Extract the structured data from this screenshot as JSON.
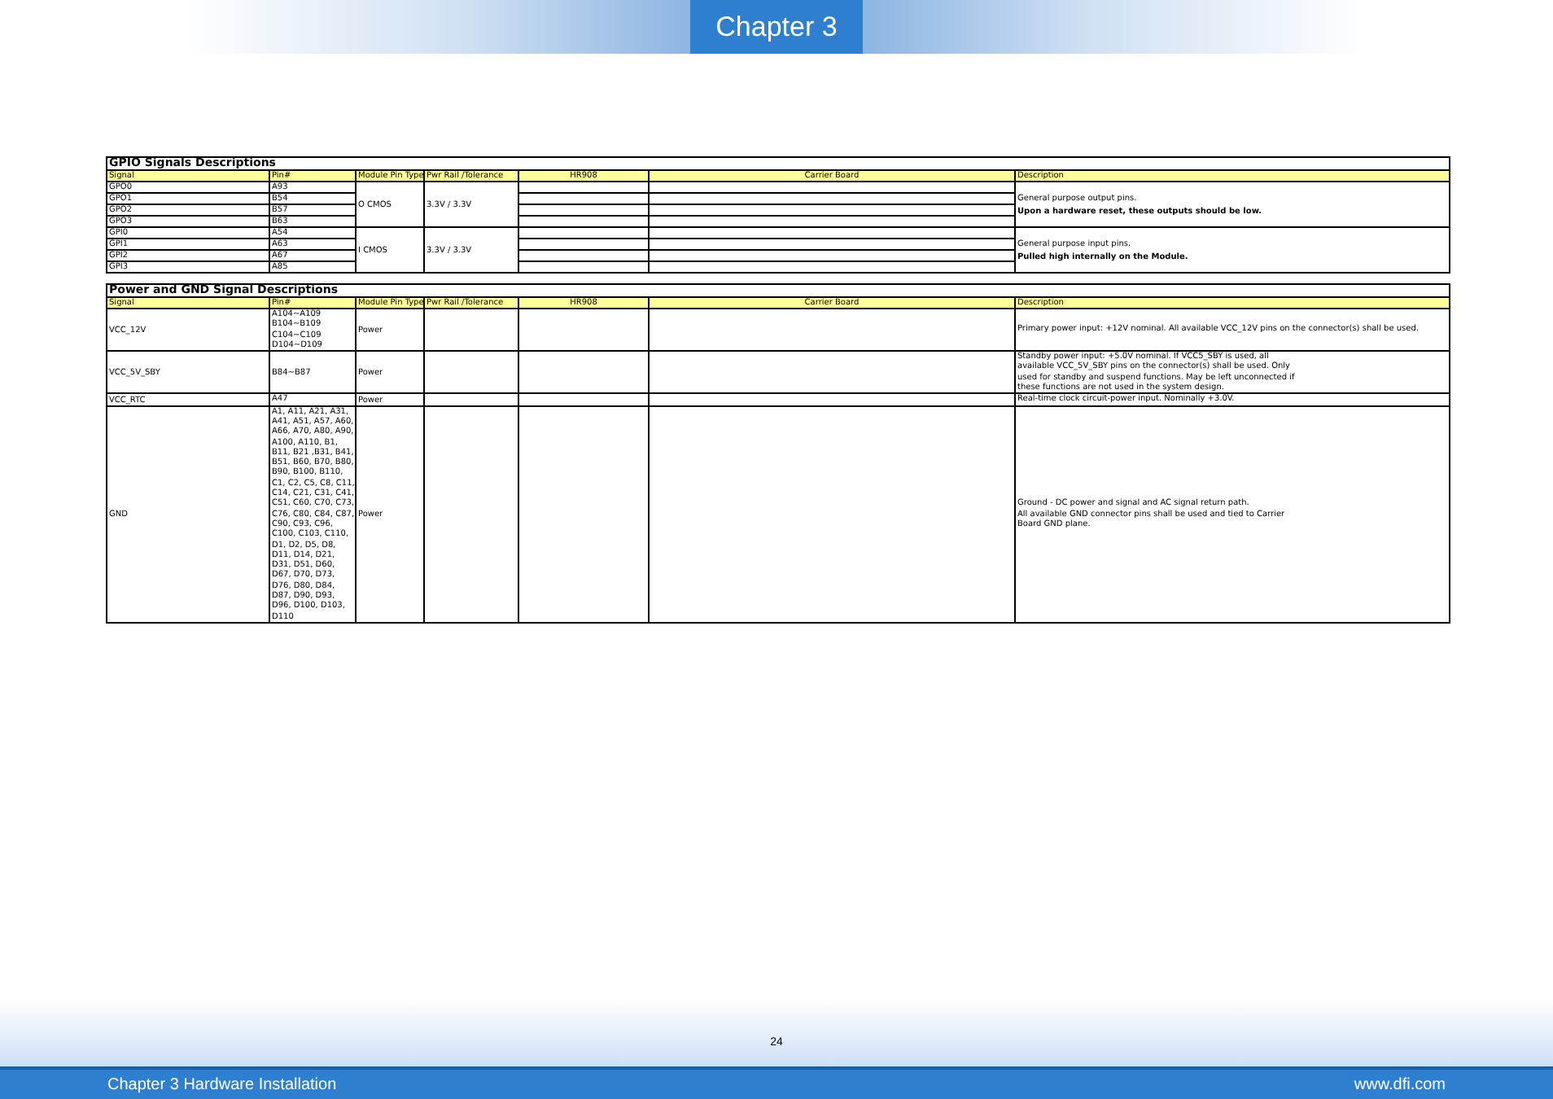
{
  "header": {
    "chapter_tab": "Chapter 3"
  },
  "gpio_table": {
    "title": "GPIO Signals Descriptions",
    "columns": [
      "Signal",
      "Pin#",
      "Module Pin Type",
      "Pwr Rail /Tolerance",
      "HR908",
      "Carrier Board",
      "Description"
    ],
    "groups": [
      {
        "type": "O CMOS",
        "rail": "3.3V / 3.3V",
        "description": [
          {
            "text": "General purpose output pins.",
            "bold": false
          },
          {
            "text": "Upon a hardware reset, these outputs should be low.",
            "bold": true
          }
        ],
        "signals": [
          {
            "signal": "GPO0",
            "pin": "A93"
          },
          {
            "signal": "GPO1",
            "pin": "B54"
          },
          {
            "signal": "GPO2",
            "pin": "B57"
          },
          {
            "signal": "GPO3",
            "pin": "B63"
          }
        ]
      },
      {
        "type": "I CMOS",
        "rail": "3.3V / 3.3V",
        "description": [
          {
            "text": "General purpose input pins.",
            "bold": false
          },
          {
            "text": "Pulled high internally on the Module.",
            "bold": true
          }
        ],
        "signals": [
          {
            "signal": "GPI0",
            "pin": "A54"
          },
          {
            "signal": "GPI1",
            "pin": "A63"
          },
          {
            "signal": "GPI2",
            "pin": "A67"
          },
          {
            "signal": "GPI3",
            "pin": "A85"
          }
        ]
      }
    ]
  },
  "power_table": {
    "title": "Power and GND Signal Descriptions",
    "columns": [
      "Signal",
      "Pin#",
      "Module Pin Type",
      "Pwr Rail /Tolerance",
      "HR908",
      "Carrier Board",
      "Description"
    ],
    "rows": [
      {
        "signal": "VCC_12V",
        "pins": [
          "A104~A109",
          "B104~B109",
          "C104~C109",
          "D104~D109"
        ],
        "type": "Power",
        "description": [
          "Primary power input: +12V nominal. All available VCC_12V pins on the connector(s) shall be used."
        ]
      },
      {
        "signal": "VCC_5V_SBY",
        "pins": [
          "B84~B87"
        ],
        "type": "Power",
        "description": [
          "Standby power input: +5.0V nominal. If VCC5_SBY is used, all",
          "available VCC_5V_SBY pins on the connector(s) shall be used. Only",
          "used for standby and suspend functions. May be left unconnected if",
          "these functions are not used in the system design."
        ]
      },
      {
        "signal": "VCC_RTC",
        "pins": [
          "A47"
        ],
        "type": "Power",
        "description": [
          "Real-time clock circuit-power input. Nominally +3.0V."
        ]
      },
      {
        "signal": "GND",
        "pins": [
          "A1, A11, A21, A31,",
          "A41, A51, A57, A60,",
          "A66, A70, A80, A90,",
          "A100, A110, B1,",
          "B11, B21 ,B31, B41,",
          "B51, B60, B70, B80,",
          "B90, B100, B110,",
          "C1, C2, C5, C8, C11,",
          "C14, C21, C31, C41,",
          "C51, C60, C70, C73,",
          "C76, C80, C84, C87,",
          "C90, C93, C96,",
          "C100, C103, C110,",
          "D1, D2, D5, D8,",
          "D11, D14, D21,",
          "D31, D51, D60,",
          "D67, D70, D73,",
          "D76, D80, D84,",
          "D87, D90, D93,",
          "D96, D100, D103,",
          "D110"
        ],
        "type": "Power",
        "description": [
          "Ground - DC power and signal and AC signal return path.",
          "All available GND connector pins shall be used and tied to Carrier",
          "Board GND plane."
        ]
      }
    ]
  },
  "footer": {
    "page_number": "24",
    "section": "Chapter 3 Hardware Installation",
    "website": "www.dfi.com"
  }
}
